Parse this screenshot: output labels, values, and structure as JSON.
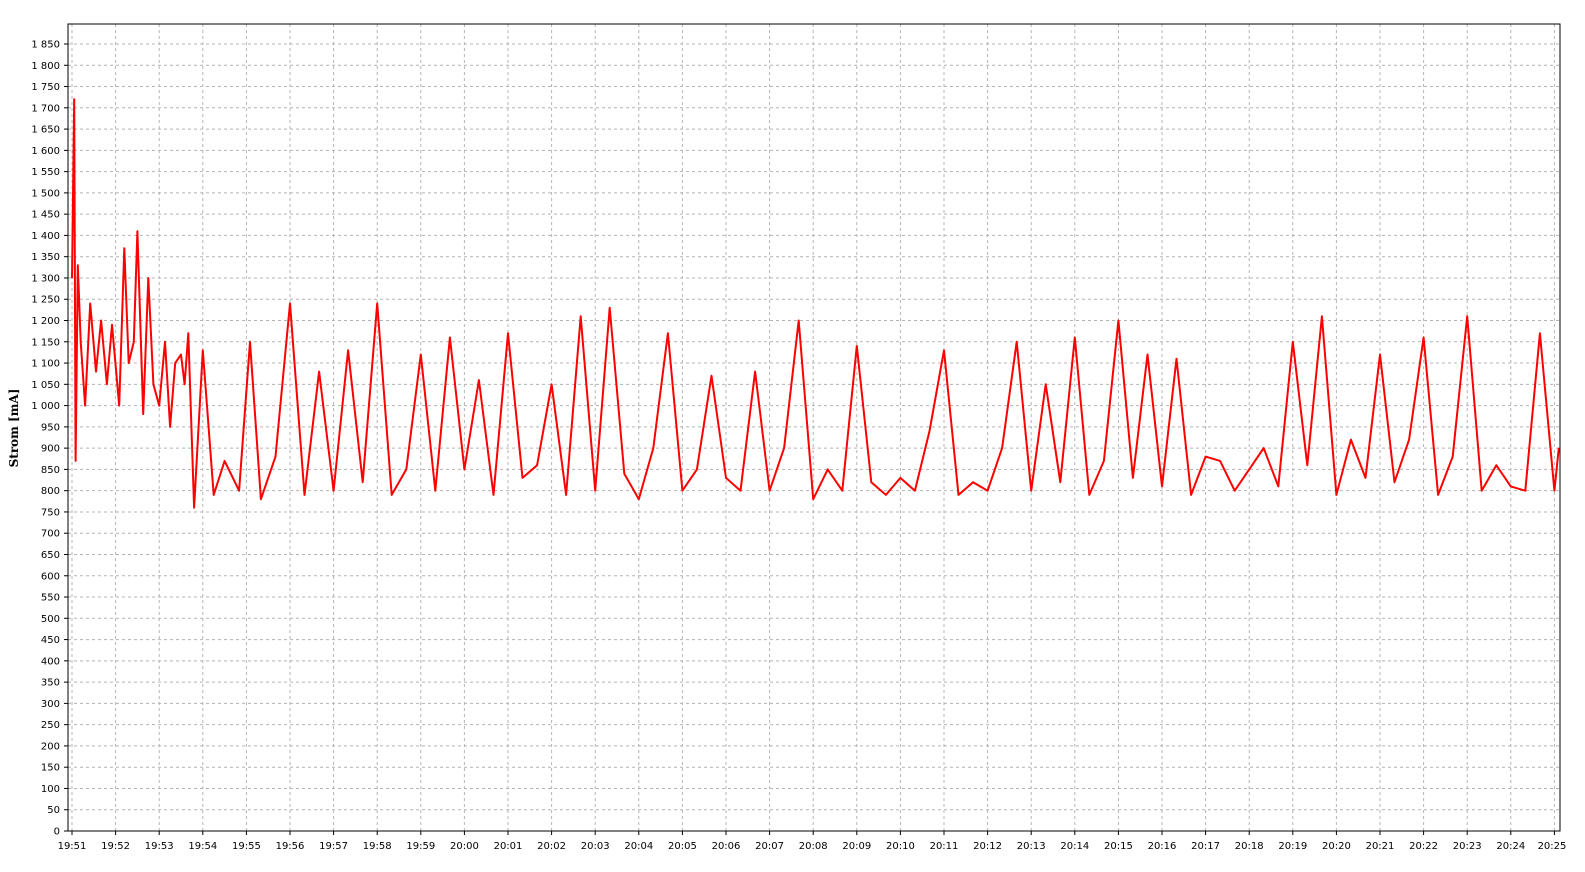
{
  "chart_data": {
    "type": "line",
    "title": "",
    "xlabel": "",
    "ylabel": "Strom [mA]",
    "ylim": [
      0,
      1900
    ],
    "yticks": [
      0,
      50,
      100,
      150,
      200,
      250,
      300,
      350,
      400,
      450,
      500,
      550,
      600,
      650,
      700,
      750,
      800,
      850,
      900,
      950,
      1000,
      1050,
      1100,
      1150,
      1200,
      1250,
      1300,
      1350,
      1400,
      1450,
      1500,
      1550,
      1600,
      1650,
      1700,
      1750,
      1800,
      1850
    ],
    "ytick_labels": [
      "0",
      "50",
      "100",
      "150",
      "200",
      "250",
      "300",
      "350",
      "400",
      "450",
      "500",
      "550",
      "600",
      "650",
      "700",
      "750",
      "800",
      "850",
      "900",
      "950",
      "1 000",
      "1 050",
      "1 100",
      "1 150",
      "1 200",
      "1 250",
      "1 300",
      "1 350",
      "1 400",
      "1 450",
      "1 500",
      "1 550",
      "1 600",
      "1 650",
      "1 700",
      "1 750",
      "1 800",
      "1 850"
    ],
    "xlim": [
      "19:51",
      "20:25"
    ],
    "xtick_labels": [
      "19:51",
      "19:52",
      "19:53",
      "19:54",
      "19:55",
      "19:56",
      "19:57",
      "19:58",
      "19:59",
      "20:00",
      "20:01",
      "20:02",
      "20:03",
      "20:04",
      "20:05",
      "20:06",
      "20:07",
      "20:08",
      "20:09",
      "20:10",
      "20:11",
      "20:12",
      "20:13",
      "20:14",
      "20:15",
      "20:16",
      "20:17",
      "20:18",
      "20:19",
      "20:20",
      "20:21",
      "20:22",
      "20:23",
      "20:24",
      "20:25"
    ],
    "grid": true,
    "series": [
      {
        "name": "",
        "color": "#ff0000",
        "x": [
          "19:51:00",
          "19:51:03",
          "19:51:05",
          "19:51:08",
          "19:51:12",
          "19:51:18",
          "19:51:25",
          "19:51:33",
          "19:51:40",
          "19:51:48",
          "19:51:55",
          "19:52:05",
          "19:52:12",
          "19:52:18",
          "19:52:25",
          "19:52:30",
          "19:52:38",
          "19:52:45",
          "19:52:52",
          "19:53:00",
          "19:53:08",
          "19:53:15",
          "19:53:22",
          "19:53:30",
          "19:53:35",
          "19:53:40",
          "19:53:48",
          "19:54:00",
          "19:54:15",
          "19:54:30",
          "19:54:50",
          "19:55:05",
          "19:55:20",
          "19:55:40",
          "19:56:00",
          "19:56:20",
          "19:56:40",
          "19:57:00",
          "19:57:20",
          "19:57:40",
          "19:58:00",
          "19:58:20",
          "19:58:40",
          "19:59:00",
          "19:59:20",
          "19:59:40",
          "20:00:00",
          "20:00:20",
          "20:00:40",
          "20:01:00",
          "20:01:20",
          "20:01:40",
          "20:02:00",
          "20:02:20",
          "20:02:40",
          "20:03:00",
          "20:03:20",
          "20:03:40",
          "20:04:00",
          "20:04:20",
          "20:04:40",
          "20:05:00",
          "20:05:20",
          "20:05:40",
          "20:06:00",
          "20:06:20",
          "20:06:40",
          "20:07:00",
          "20:07:20",
          "20:07:40",
          "20:08:00",
          "20:08:20",
          "20:08:40",
          "20:09:00",
          "20:09:20",
          "20:09:40",
          "20:10:00",
          "20:10:20",
          "20:10:40",
          "20:11:00",
          "20:11:20",
          "20:11:40",
          "20:12:00",
          "20:12:20",
          "20:12:40",
          "20:13:00",
          "20:13:20",
          "20:13:40",
          "20:14:00",
          "20:14:20",
          "20:14:40",
          "20:15:00",
          "20:15:20",
          "20:15:40",
          "20:16:00",
          "20:16:20",
          "20:16:40",
          "20:17:00",
          "20:17:20",
          "20:17:40",
          "20:18:00",
          "20:18:20",
          "20:18:40",
          "20:19:00",
          "20:19:20",
          "20:19:40",
          "20:20:00",
          "20:20:20",
          "20:20:40",
          "20:21:00",
          "20:21:20",
          "20:21:40",
          "20:22:00",
          "20:22:20",
          "20:22:40",
          "20:23:00",
          "20:23:20",
          "20:23:40",
          "20:24:00",
          "20:24:20",
          "20:24:40",
          "20:25:00",
          "20:25:06"
        ],
        "y": [
          1300,
          1720,
          870,
          1330,
          1150,
          1000,
          1240,
          1080,
          1200,
          1050,
          1190,
          1000,
          1370,
          1100,
          1150,
          1410,
          980,
          1300,
          1050,
          1000,
          1150,
          950,
          1100,
          1120,
          1050,
          1170,
          760,
          1130,
          790,
          870,
          800,
          1150,
          780,
          880,
          1240,
          790,
          1080,
          800,
          1130,
          820,
          1240,
          790,
          850,
          1120,
          800,
          1160,
          850,
          1060,
          790,
          1170,
          830,
          860,
          1050,
          790,
          1210,
          800,
          1230,
          840,
          780,
          900,
          1170,
          800,
          850,
          1070,
          830,
          800,
          1080,
          800,
          900,
          1200,
          780,
          850,
          800,
          1140,
          820,
          790,
          830,
          800,
          940,
          1130,
          790,
          820,
          800,
          900,
          1150,
          800,
          1050,
          820,
          1160,
          790,
          870,
          1200,
          830,
          1120,
          810,
          1110,
          790,
          880,
          870,
          800,
          850,
          900,
          810,
          1150,
          860,
          1210,
          790,
          920,
          830,
          1120,
          820,
          920,
          1160,
          790,
          880,
          1210,
          800,
          860,
          810,
          800,
          1170,
          800,
          900
        ]
      }
    ]
  }
}
